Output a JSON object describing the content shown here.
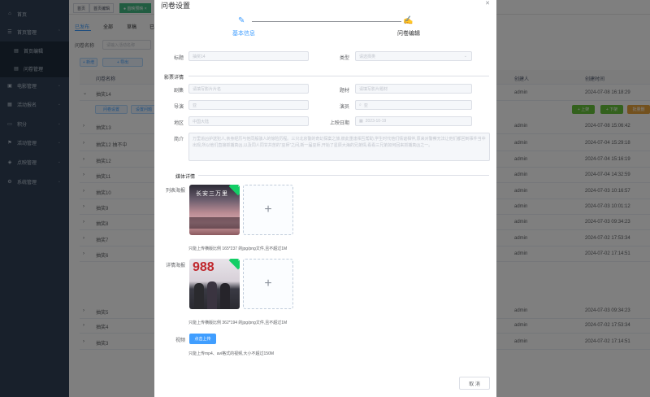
{
  "sidebar": {
    "items": [
      {
        "icon": "home-icon",
        "label": "首页"
      },
      {
        "icon": "list-icon",
        "label": "首页管理"
      },
      {
        "icon": "doc-icon",
        "label": "首页编辑"
      },
      {
        "icon": "doc-icon",
        "label": "问卷管理"
      },
      {
        "icon": "film-icon",
        "label": "电影管理"
      },
      {
        "icon": "calendar-icon",
        "label": "活动报名"
      },
      {
        "icon": "folder-icon",
        "label": "积分"
      },
      {
        "icon": "flag-icon",
        "label": "活动管理"
      },
      {
        "icon": "box-icon",
        "label": "点映管理"
      },
      {
        "icon": "gear-icon",
        "label": "系统管理"
      }
    ]
  },
  "tags": [
    "首页",
    "首页编辑",
    "● 首映预映 ×"
  ],
  "tabs": [
    "已发布",
    "全部",
    "草稿",
    "已"
  ],
  "filter": {
    "label": "问卷名称",
    "placeholder": "请输入活动名称"
  },
  "toolbar": {
    "add": "+ 新增",
    "import": "+ 导出",
    "export": "导出",
    "right1": "+ 上架",
    "right2": "+ 下架",
    "right3": "批量删"
  },
  "table": {
    "headers": {
      "name": "问卷名称",
      "creator": "创建人",
      "time": "创建时间"
    },
    "rows": [
      {
        "name": "抽奖14",
        "creator": "admin",
        "time": "2024-07-08 16:18:29",
        "expanded": true
      },
      {
        "name": "抽奖13",
        "creator": "admin",
        "time": "2024-07-08 15:06:42"
      },
      {
        "name": "抽奖12 抽不中",
        "creator": "admin",
        "time": "2024-07-04 15:29:18"
      },
      {
        "name": "抽奖12",
        "creator": "admin",
        "time": "2024-07-04 15:16:19"
      },
      {
        "name": "抽奖11",
        "creator": "admin",
        "time": "2024-07-04 14:32:59"
      },
      {
        "name": "抽奖10",
        "creator": "admin",
        "time": "2024-07-03 10:16:57"
      },
      {
        "name": "抽奖9",
        "creator": "admin",
        "time": "2024-07-03 10:01:12"
      },
      {
        "name": "抽奖8",
        "creator": "admin",
        "time": "2024-07-03 09:34:23"
      },
      {
        "name": "抽奖7",
        "creator": "admin",
        "time": "2024-07-02 17:53:34"
      },
      {
        "name": "抽奖6",
        "creator": "admin",
        "time": "2024-07-02 17:14:51"
      },
      {
        "name": "抽奖5",
        "creator": "admin",
        "time": "2024-07-03 09:34:23"
      },
      {
        "name": "抽奖4",
        "creator": "admin",
        "time": "2024-07-02 17:53:34"
      },
      {
        "name": "抽奖3",
        "creator": "admin",
        "time": "2024-07-02 17:14:51"
      }
    ],
    "expanded_buttons": [
      "问卷设置",
      "设置问题"
    ]
  },
  "dialog": {
    "title": "问卷设置",
    "steps": [
      "基本信息",
      "问卷编辑"
    ],
    "fields": {
      "title_label": "标题",
      "title_value": "抽奖14",
      "type_label": "类型",
      "type_placeholder": "请选择类",
      "section_film": "影票详情",
      "series_label": "剧集",
      "series_placeholder": "请填写影片片名",
      "theme_label": "题材",
      "theme_placeholder": "请填写影片题材",
      "director_label": "导演",
      "director_value": "亚",
      "actor_label": "演员",
      "actor_value": "亚",
      "region_label": "地区",
      "region_value": "中国大陆",
      "release_label": "上映日期",
      "release_value": "2023-10-19",
      "intro_label": "简介",
      "intro_value": "万里追凶护送犯人,亲身经历与他同般骇人的惊险历程。三只北京警的奇幻探案之旅,彼此重逢相互帮助,学生时代他们情谊相伴,原来对警察无法让他们都回到事件当中出现,所以他们直接抓捕真凶,以及同人同甘共苦的“巫师”之间,新一届巫师,开始了星辰大海的兄弟情,看看三兄弟如何回来抓捕真凶之一。",
      "section_media": "媒体详情",
      "list_poster_label": "列表海报",
      "list_poster_hint": "只能上传横版比例 165*237 的jpg/png文件,且不超过1M",
      "detail_poster_label": "详情海报",
      "detail_poster_hint": "只能上传横版比例 362*194 的jpg/png文件,且不超过1M",
      "video_label": "视频",
      "video_button": "点击上传",
      "video_hint": "只能上传mp4、avi格式的视频,大小不超过150M",
      "cancel": "取 消"
    }
  }
}
